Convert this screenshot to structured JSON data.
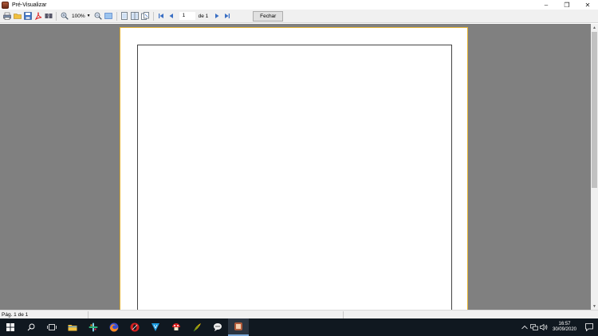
{
  "window": {
    "title": "Pré-Visualizar",
    "controls": {
      "minimize": "–",
      "restore": "❐",
      "close": "✕"
    }
  },
  "toolbar": {
    "zoom_value": "100%",
    "page_number": "1",
    "page_of_label": "de 1",
    "close_label": "Fechar",
    "icons": [
      "print-icon",
      "open-icon",
      "save-icon",
      "pdf-icon",
      "find-icon",
      "zoom-in-icon",
      "zoom-out-icon",
      "fit-page-icon",
      "single-page-icon",
      "two-pages-icon",
      "multi-page-icon",
      "first-page-icon",
      "previous-page-icon",
      "next-page-icon",
      "last-page-icon"
    ]
  },
  "status": {
    "page_info": "Pág. 1 de 1"
  },
  "taskbar": {
    "time": "16:57",
    "date": "30/09/2020"
  },
  "colors": {
    "preview_bg": "#808080",
    "page_border": "#e0b030",
    "taskbar_bg": "#101820"
  }
}
